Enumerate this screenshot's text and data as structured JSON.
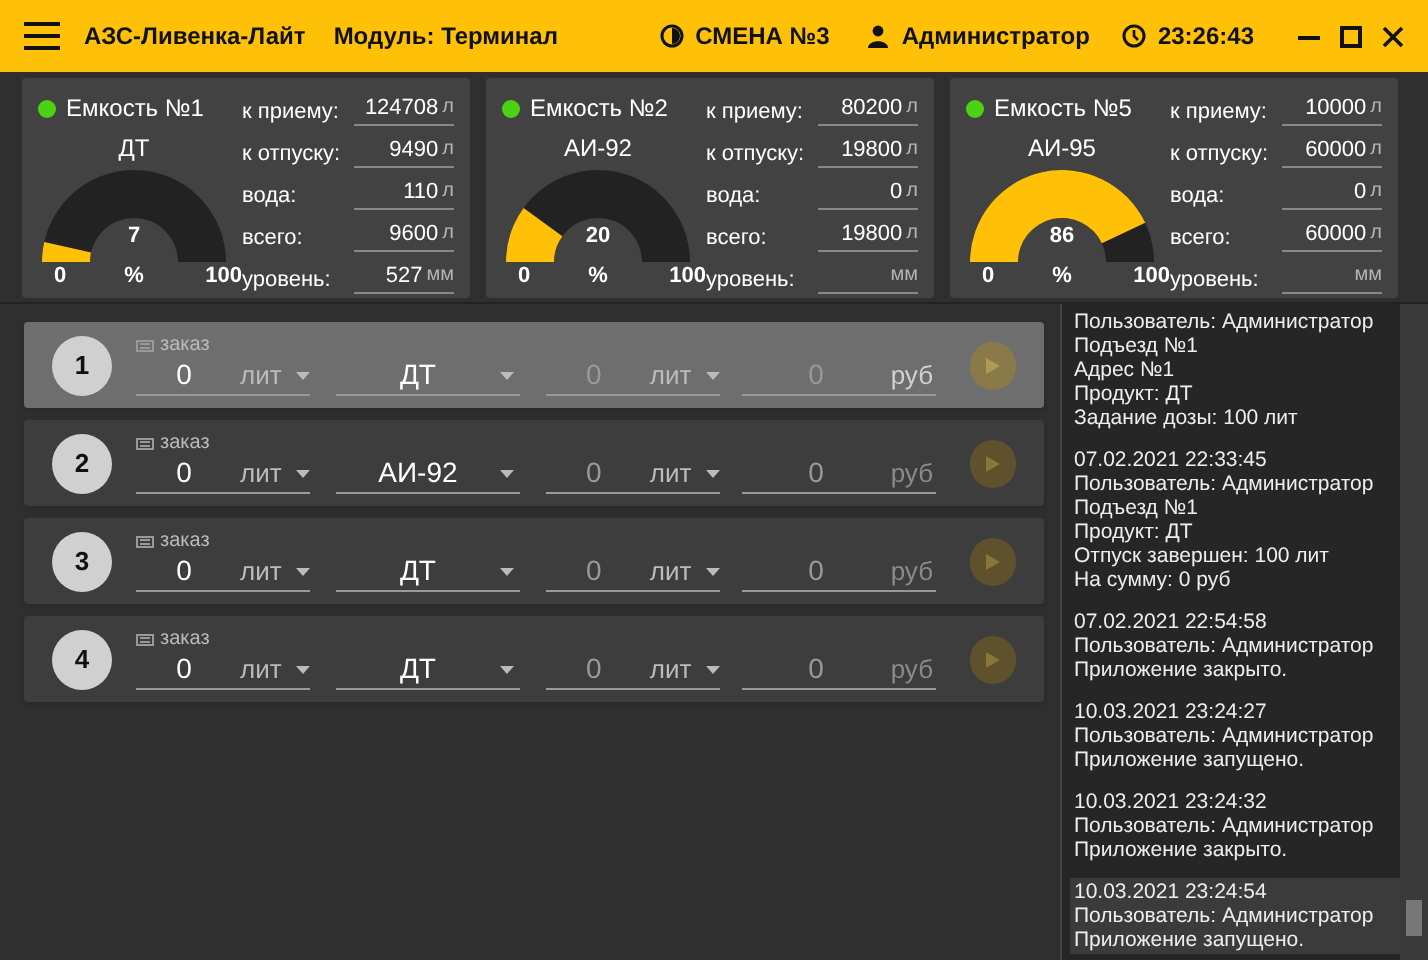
{
  "header": {
    "title": "АЗС-Ливенка-Лайт",
    "module": "Модуль: Терминал",
    "shift": "СМЕНА №3",
    "user": "Администратор",
    "time": "23:26:43"
  },
  "tanks": [
    {
      "name": "Емкость №1",
      "color": "#4cd213",
      "product": "ДТ",
      "percent": "7",
      "percent_unit": "%",
      "min": "0",
      "max": "100",
      "fields": [
        {
          "label": "к приему:",
          "value": "124708",
          "unit": "л"
        },
        {
          "label": "к отпуску:",
          "value": "9490",
          "unit": "л"
        },
        {
          "label": "вода:",
          "value": "110",
          "unit": "л"
        },
        {
          "label": "всего:",
          "value": "9600",
          "unit": "л"
        },
        {
          "label": "уровень:",
          "value": "527",
          "unit": "мм"
        }
      ]
    },
    {
      "name": "Емкость №2",
      "color": "#4cd213",
      "product": "АИ-92",
      "percent": "20",
      "percent_unit": "%",
      "min": "0",
      "max": "100",
      "fields": [
        {
          "label": "к приему:",
          "value": "80200",
          "unit": "л"
        },
        {
          "label": "к отпуску:",
          "value": "19800",
          "unit": "л"
        },
        {
          "label": "вода:",
          "value": "0",
          "unit": "л"
        },
        {
          "label": "всего:",
          "value": "19800",
          "unit": "л"
        },
        {
          "label": "уровень:",
          "unit": "мм"
        }
      ]
    },
    {
      "name": "Емкость №5",
      "color": "#4cd213",
      "product": "АИ-95",
      "percent": "86",
      "percent_unit": "%",
      "min": "0",
      "max": "100",
      "fields": [
        {
          "label": "к приему:",
          "value": "10000",
          "unit": "л"
        },
        {
          "label": "к отпуску:",
          "value": "60000",
          "unit": "л"
        },
        {
          "label": "вода:",
          "value": "0",
          "unit": "л"
        },
        {
          "label": "всего:",
          "value": "60000",
          "unit": "л"
        },
        {
          "label": "уровень:",
          "unit": "мм"
        }
      ]
    }
  ],
  "dispensers": [
    {
      "number": "1",
      "selected": true,
      "order_label": "заказ",
      "qty": "0",
      "qty_unit": "лит",
      "product": "ДТ",
      "liters": "0",
      "liters_unit": "лит",
      "sum": "0",
      "sum_unit": "руб"
    },
    {
      "number": "2",
      "selected": false,
      "order_label": "заказ",
      "qty": "0",
      "qty_unit": "лит",
      "product": "АИ-92",
      "liters": "0",
      "liters_unit": "лит",
      "sum": "0",
      "sum_unit": "руб"
    },
    {
      "number": "3",
      "selected": false,
      "order_label": "заказ",
      "qty": "0",
      "qty_unit": "лит",
      "product": "ДТ",
      "liters": "0",
      "liters_unit": "лит",
      "sum": "0",
      "sum_unit": "руб"
    },
    {
      "number": "4",
      "selected": false,
      "order_label": "заказ",
      "qty": "0",
      "qty_unit": "лит",
      "product": "ДТ",
      "liters": "0",
      "liters_unit": "лит",
      "sum": "0",
      "sum_unit": "руб"
    }
  ],
  "log": [
    {
      "selected": false,
      "lines": [
        "Пользователь: Администратор",
        "Подъезд №1",
        "Адрес №1",
        "Продукт: ДТ",
        "Задание дозы: 100 лит"
      ]
    },
    {
      "selected": false,
      "lines": [
        "07.02.2021 22:33:45",
        "Пользователь: Администратор",
        "Подъезд №1",
        "Продукт: ДТ",
        "Отпуск завершен: 100 лит",
        "На сумму: 0 руб"
      ]
    },
    {
      "selected": false,
      "lines": [
        "07.02.2021 22:54:58",
        "Пользователь: Администратор",
        "Приложение закрыто."
      ]
    },
    {
      "selected": false,
      "lines": [
        "10.03.2021 23:24:27",
        "Пользователь: Администратор",
        "Приложение запущено."
      ]
    },
    {
      "selected": false,
      "lines": [
        "10.03.2021 23:24:32",
        "Пользователь: Администратор",
        "Приложение закрыто."
      ]
    },
    {
      "selected": true,
      "lines": [
        "10.03.2021 23:24:54",
        "Пользователь: Администратор",
        "Приложение запущено."
      ]
    }
  ]
}
